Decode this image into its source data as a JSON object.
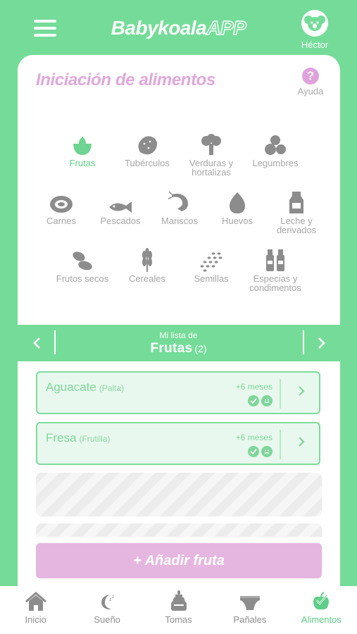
{
  "header": {
    "brand_main": "Babykoala",
    "brand_suffix": "APP",
    "user_name": "Héctor"
  },
  "section": {
    "title": "Iniciación de alimentos",
    "help_label": "Ayuda",
    "help_icon": "?"
  },
  "categories": [
    {
      "label": "Frutas",
      "icon": "fruit-icon",
      "active": true
    },
    {
      "label": "Tubérculos",
      "icon": "potato-icon"
    },
    {
      "label": "Verduras y hortalizas",
      "icon": "broccoli-icon"
    },
    {
      "label": "Legumbres",
      "icon": "legumes-icon"
    },
    {
      "label": "Carnes",
      "icon": "meat-icon"
    },
    {
      "label": "Pescados",
      "icon": "fish-icon"
    },
    {
      "label": "Mariscos",
      "icon": "shrimp-icon"
    },
    {
      "label": "Huevos",
      "icon": "egg-icon"
    },
    {
      "label": "Leche y derivados",
      "icon": "milk-icon"
    },
    {
      "label": "Frutos secos",
      "icon": "nuts-icon"
    },
    {
      "label": "Cereales",
      "icon": "wheat-icon"
    },
    {
      "label": "Semillas",
      "icon": "seeds-icon"
    },
    {
      "label": "Especias y condimentos",
      "icon": "spices-icon"
    }
  ],
  "list": {
    "caption": "Mi lista de",
    "title": "Frutas",
    "count": "(2)",
    "items": [
      {
        "name": "Aguacate",
        "alt": "(Palta)",
        "age": "+6 meses",
        "reaction": "happy"
      },
      {
        "name": "Fresa",
        "alt": "(Frutilla)",
        "age": "+6 meses",
        "reaction": "sad"
      }
    ]
  },
  "add_button": "+ Añadir fruta",
  "bottom_nav": [
    {
      "label": "Inicio",
      "icon": "home-icon"
    },
    {
      "label": "Sueño",
      "icon": "moon-icon"
    },
    {
      "label": "Tomas",
      "icon": "bottle-icon"
    },
    {
      "label": "Pañales",
      "icon": "diaper-icon"
    },
    {
      "label": "Alimentos",
      "icon": "apple-icon",
      "active": true
    }
  ],
  "colors": {
    "primary_green": "#74dc98",
    "accent_pink": "#e0a8dc",
    "inactive_gray": "#a6a6a6"
  }
}
